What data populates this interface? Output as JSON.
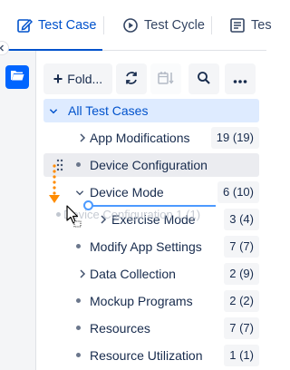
{
  "tabs": [
    {
      "label": "Test Case",
      "icon": "edit-document-icon",
      "active": true
    },
    {
      "label": "Test Cycle",
      "icon": "play-cycle-icon",
      "active": false
    },
    {
      "label": "Tes",
      "icon": "list-document-icon",
      "active": false
    }
  ],
  "toolbar": {
    "folder_label": "Fold...",
    "buttons": [
      "plus-icon",
      "refresh-icon",
      "calendar-sort-icon",
      "search-icon",
      "more-icon"
    ]
  },
  "tree": {
    "root": {
      "label": "All Test Cases"
    },
    "items": [
      {
        "label": "App Modifications",
        "count": "19 (19)",
        "expandable": true,
        "expanded": false
      },
      {
        "label": "Device Configuration",
        "count": "",
        "dragging": true
      },
      {
        "label": "Device Mode",
        "count": "6 (10)",
        "expandable": true,
        "expanded": true
      },
      {
        "label": "Exercise Mode",
        "count": "3 (4)",
        "expandable": true,
        "expanded": false,
        "child": true
      },
      {
        "label": "Modify App Settings",
        "count": "7 (7)",
        "expandable": false
      },
      {
        "label": "Data Collection",
        "count": "2 (9)",
        "expandable": true,
        "expanded": false
      },
      {
        "label": "Mockup Programs",
        "count": "2 (2)",
        "expandable": false
      },
      {
        "label": "Resources",
        "count": "7 (7)",
        "expandable": false
      },
      {
        "label": "Resource Utilization",
        "count": "1 (1)",
        "expandable": false
      }
    ],
    "ghost_label": "Device Configuration  1 (1)"
  },
  "colors": {
    "accent": "#0052cc",
    "root_bg": "#deebff",
    "drop_indicator": "#4c9aff",
    "drag_arrow": "#ff8b00"
  }
}
